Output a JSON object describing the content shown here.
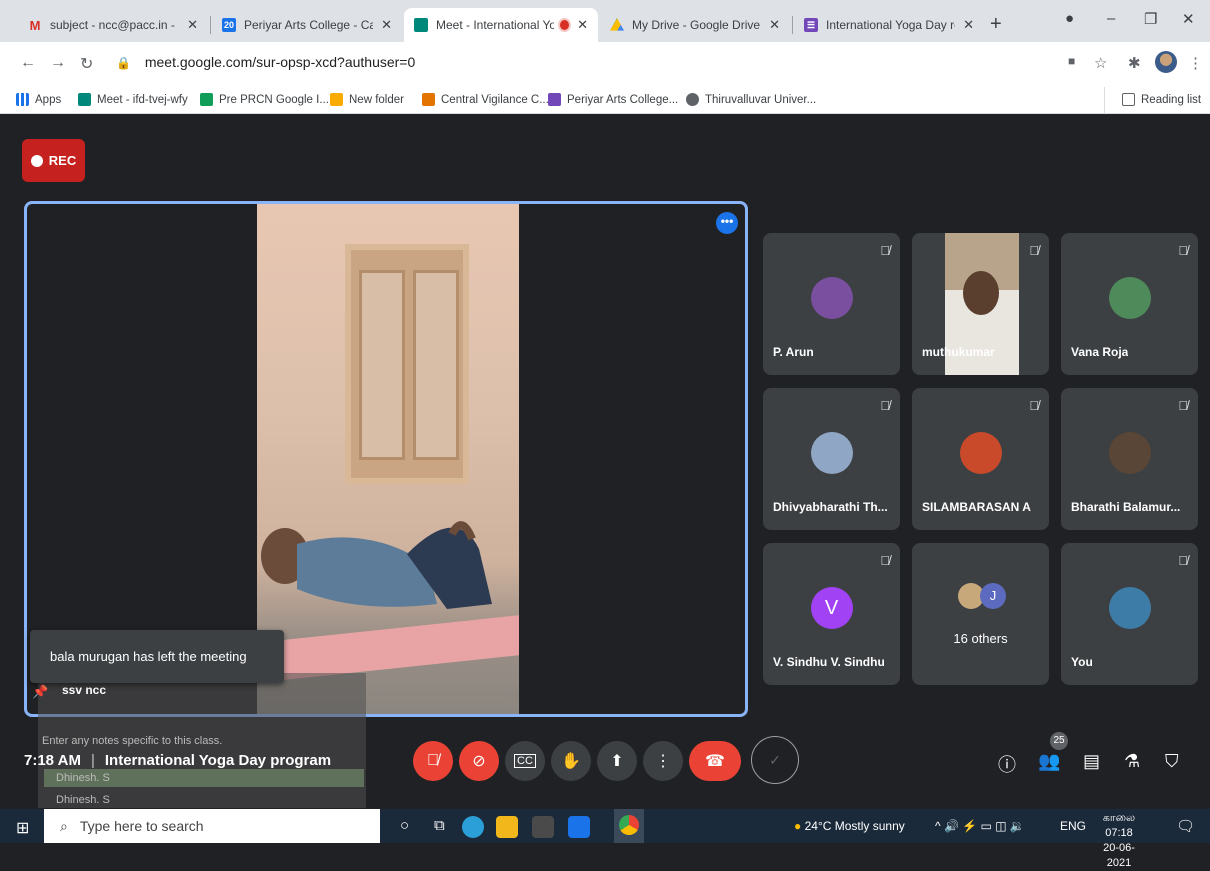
{
  "browser": {
    "tabs": [
      {
        "title": "subject - ncc@pacc.in - Periy",
        "icon": "gmail-icon",
        "color": "#d93025"
      },
      {
        "title": "Periyar Arts College - Calenda",
        "icon": "calendar-icon",
        "color": "#1a73e8"
      },
      {
        "title": "Meet - International Yoga",
        "icon": "meet-icon",
        "color": "#00897b"
      },
      {
        "title": "My Drive - Google Drive",
        "icon": "drive-icon",
        "color": "#fbbc04"
      },
      {
        "title": "International Yoga Day reg - ",
        "icon": "forms-icon",
        "color": "#7248b9"
      }
    ],
    "new_tab": "+",
    "url": "meet.google.com/sur-opsp-xcd?authuser=0",
    "bookmarks": [
      {
        "label": "Apps",
        "color": "#1a73e8"
      },
      {
        "label": "Meet - ifd-tvej-wfy",
        "color": "#00897b"
      },
      {
        "label": "Pre PRCN Google I...",
        "color": "#0f9d58"
      },
      {
        "label": "New folder",
        "color": "#f9ab00"
      },
      {
        "label": "Central Vigilance C...",
        "color": "#e37400"
      },
      {
        "label": "Periyar Arts College...",
        "color": "#7248b9"
      },
      {
        "label": "Thiruvalluvar Univer...",
        "color": "#5f6368"
      }
    ],
    "reading_list": "Reading list"
  },
  "meet": {
    "rec_label": "REC",
    "toast": "bala murugan has left the meeting",
    "overlay": {
      "title": "ssv ncc",
      "notes": "Enter any notes specific to this class.",
      "row1": "Dhinesh. S",
      "row2": "Dhinesh. S"
    },
    "participants": [
      {
        "name": "P. Arun",
        "avatar": "#7b4fa0"
      },
      {
        "name": "muthukumar",
        "avatar": "#6b5a4a"
      },
      {
        "name": "Vana Roja",
        "avatar": "#4f8a5a"
      },
      {
        "name": "Dhivyabharathi Th...",
        "avatar": "#8fa6c4"
      },
      {
        "name": "SILAMBARASAN A",
        "avatar": "#c94a2a"
      },
      {
        "name": "Bharathi Balamur...",
        "avatar": "#5a4636"
      },
      {
        "name": "V. Sindhu V. Sindhu",
        "avatar": "#a142f4",
        "initial": "V"
      },
      {
        "name": "16 others",
        "avatar": "#5c6bc0",
        "initial": "J"
      },
      {
        "name": "You",
        "avatar": "#3e7ca8"
      }
    ],
    "time": "7:18 AM",
    "meeting_title": "International Yoga Day program",
    "people_count": "25"
  },
  "taskbar": {
    "search_placeholder": "Type here to search",
    "weather": "24°C  Mostly sunny",
    "lang": "ENG",
    "clock_time": "காலை 07:18",
    "clock_date": "20-06-2021"
  }
}
